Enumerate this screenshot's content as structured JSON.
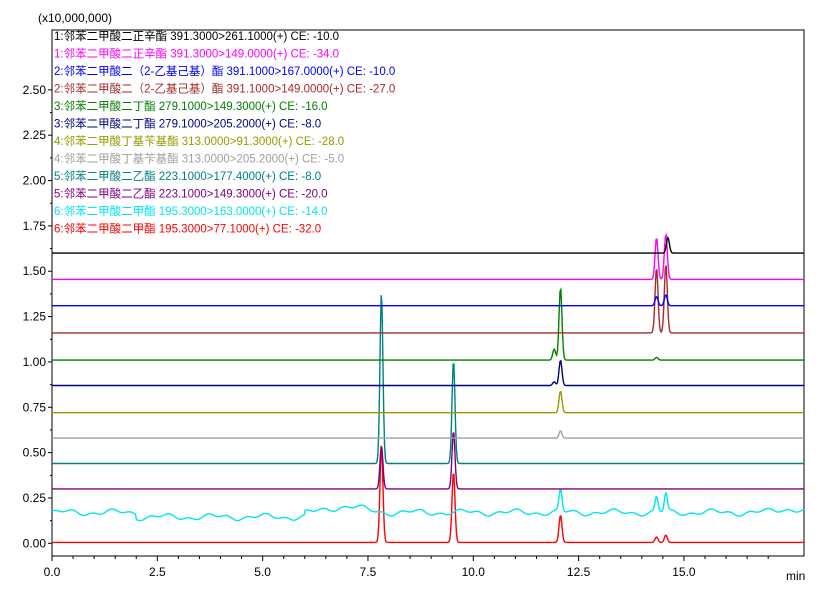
{
  "chart_data": {
    "type": "line",
    "y_multiplier_label": "(x10,000,000)",
    "x_unit": "min",
    "xlim": [
      0,
      17.85
    ],
    "ylim": [
      -0.07,
      2.83
    ],
    "x_ticks": [
      {
        "v": 0,
        "label": "0.0"
      },
      {
        "v": 2.5,
        "label": "2.5"
      },
      {
        "v": 5,
        "label": "5.0"
      },
      {
        "v": 7.5,
        "label": "7.5"
      },
      {
        "v": 10,
        "label": "10.0"
      },
      {
        "v": 12.5,
        "label": "12.5"
      },
      {
        "v": 15,
        "label": "15.0"
      }
    ],
    "y_ticks": [
      {
        "v": 0,
        "label": "0.00"
      },
      {
        "v": 0.25,
        "label": "0.25"
      },
      {
        "v": 0.5,
        "label": "0.50"
      },
      {
        "v": 0.75,
        "label": "0.75"
      },
      {
        "v": 1.0,
        "label": "1.00"
      },
      {
        "v": 1.25,
        "label": "1.25"
      },
      {
        "v": 1.5,
        "label": "1.50"
      },
      {
        "v": 1.75,
        "label": "1.75"
      },
      {
        "v": 2.0,
        "label": "2.00"
      },
      {
        "v": 2.25,
        "label": "2.25"
      },
      {
        "v": 2.5,
        "label": "2.50"
      }
    ],
    "series": [
      {
        "name": "1:邻苯二甲酸二正辛酯 391.3000>261.1000(+) CE: -10.0",
        "color": "#000000",
        "baseline": 1.6,
        "noise": 0,
        "peaks": [
          [
            14.62,
            0.085
          ]
        ]
      },
      {
        "name": "1:邻苯二甲酸二正辛酯 391.3000>149.0000(+) CE: -34.0",
        "color": "#ff00ff",
        "baseline": 1.455,
        "noise": 0,
        "peaks": [
          [
            14.35,
            0.23
          ],
          [
            14.57,
            0.25
          ]
        ]
      },
      {
        "name": "2:邻苯二甲酸二（2-乙基己基）酯 391.1000>167.0000(+) CE: -10.0",
        "color": "#0000ff",
        "baseline": 1.31,
        "noise": 0,
        "peaks": [
          [
            14.35,
            0.05
          ],
          [
            14.57,
            0.06
          ]
        ]
      },
      {
        "name": "2:邻苯二甲酸二（2-乙基己基）酯 391.1000>149.0000(+) CE: -27.0",
        "color": "#a52a2a",
        "baseline": 1.16,
        "noise": 0,
        "peaks": [
          [
            14.35,
            0.36
          ],
          [
            14.57,
            0.38
          ]
        ]
      },
      {
        "name": "3:邻苯二甲酸二丁酯 279.1000>149.3000(+) CE: -16.0",
        "color": "#008000",
        "baseline": 1.01,
        "noise": 0,
        "peaks": [
          [
            11.92,
            0.06
          ],
          [
            12.07,
            0.4
          ],
          [
            14.35,
            0.015
          ]
        ]
      },
      {
        "name": "3:邻苯二甲酸二丁酯 279.1000>205.2000(+) CE: -8.0",
        "color": "#000080",
        "baseline": 0.87,
        "noise": 0,
        "peaks": [
          [
            11.92,
            0.02
          ],
          [
            12.07,
            0.14
          ]
        ]
      },
      {
        "name": "4:邻苯二甲酸丁基苄基酯 313.0000>91.3000(+) CE: -28.0",
        "color": "#999900",
        "baseline": 0.72,
        "noise": 0,
        "peaks": [
          [
            12.07,
            0.12
          ]
        ]
      },
      {
        "name": "4:邻苯二甲酸丁基苄基酯 313.0000>205.2000(+) CE: -5.0",
        "color": "#a0a0a0",
        "baseline": 0.58,
        "noise": 0,
        "peaks": [
          [
            12.07,
            0.04
          ]
        ]
      },
      {
        "name": "5:邻苯二甲酸二乙酯 223.1000>177.4000(+) CE: -8.0",
        "color": "#008080",
        "baseline": 0.44,
        "noise": 0,
        "peaks": [
          [
            7.82,
            0.94
          ],
          [
            9.53,
            0.57
          ]
        ]
      },
      {
        "name": "5:邻苯二甲酸二乙酯 223.1000>149.3000(+) CE: -20.0",
        "color": "#800080",
        "baseline": 0.3,
        "noise": 0,
        "peaks": [
          [
            7.82,
            0.24
          ],
          [
            9.53,
            0.32
          ]
        ]
      },
      {
        "name": "6:邻苯二甲酸二甲酯 195.3000>163.0000(+) CE: -14.0",
        "color": "#00e5ee",
        "baseline": 0.17,
        "noise": 1,
        "peaks": [
          [
            12.07,
            0.12
          ],
          [
            14.35,
            0.08
          ],
          [
            14.57,
            0.1
          ]
        ]
      },
      {
        "name": "6:邻苯二甲酸二甲酯 195.3000>77.1000(+) CE: -32.0",
        "color": "#ff0000",
        "baseline": 0.005,
        "noise": 0,
        "peaks": [
          [
            7.82,
            0.53
          ],
          [
            9.53,
            0.39
          ],
          [
            12.07,
            0.15
          ],
          [
            14.35,
            0.03
          ],
          [
            14.57,
            0.04
          ]
        ]
      }
    ]
  }
}
